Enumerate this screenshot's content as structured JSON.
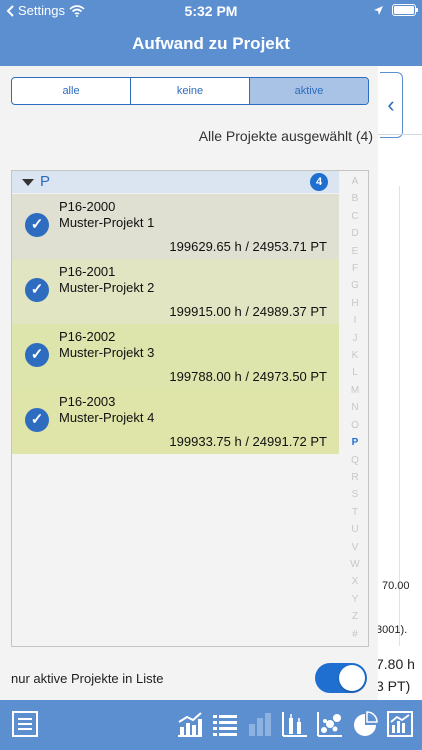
{
  "status_bar": {
    "back_app": "Settings",
    "time": "5:32 PM",
    "icons": [
      "back-arrow",
      "wifi-icon",
      "location-arrow-icon",
      "battery-icon"
    ]
  },
  "header": {
    "title": "Aufwand zu Projekt"
  },
  "filter": {
    "options": [
      "alle",
      "keine",
      "aktive"
    ],
    "selected": "aktive"
  },
  "selection_info": "Alle Projekte ausgewählt (4)",
  "group": {
    "letter": "P",
    "count": "4"
  },
  "projects": [
    {
      "code": "P16-2000",
      "name": "Muster-Projekt 1",
      "hours": "199629.65 h / 24953.71 PT",
      "checked": true,
      "color": "#dfe0d2"
    },
    {
      "code": "P16-2001",
      "name": "Muster-Projekt 2",
      "hours": "199915.00 h / 24989.37 PT",
      "checked": true,
      "color": "#e2e5c2"
    },
    {
      "code": "P16-2002",
      "name": "Muster-Projekt 3",
      "hours": "199788.00 h / 24973.50 PT",
      "checked": true,
      "color": "#dde4ac"
    },
    {
      "code": "P16-2003",
      "name": "Muster-Projekt 4",
      "hours": "199933.75 h / 24991.72 PT",
      "checked": true,
      "color": "#dfe5a8"
    }
  ],
  "index_letters": [
    "A",
    "B",
    "C",
    "D",
    "E",
    "F",
    "G",
    "H",
    "I",
    "J",
    "K",
    "L",
    "M",
    "N",
    "O",
    "P",
    "Q",
    "R",
    "S",
    "T",
    "U",
    "V",
    "W",
    "X",
    "Y",
    "Z",
    "#"
  ],
  "index_active": "P",
  "toggle": {
    "label": "nur aktive Projekte in Liste",
    "on": true
  },
  "background_panel": {
    "value_1": "70.00",
    "value_2": "3001).",
    "value_3": "7.80 h",
    "value_4": "3 PT)"
  },
  "tab_bar": {
    "icons": [
      "document-list-icon",
      "bar-line-chart-icon",
      "list-bullets-icon",
      "bar-chart-icon",
      "error-bar-chart-icon",
      "bubble-chart-icon",
      "pie-chart-icon",
      "report-chart-icon"
    ]
  },
  "colors": {
    "primary": "#5c8fd0",
    "accent": "#1f6fd1",
    "segment_selected": "#a8c3e6"
  }
}
